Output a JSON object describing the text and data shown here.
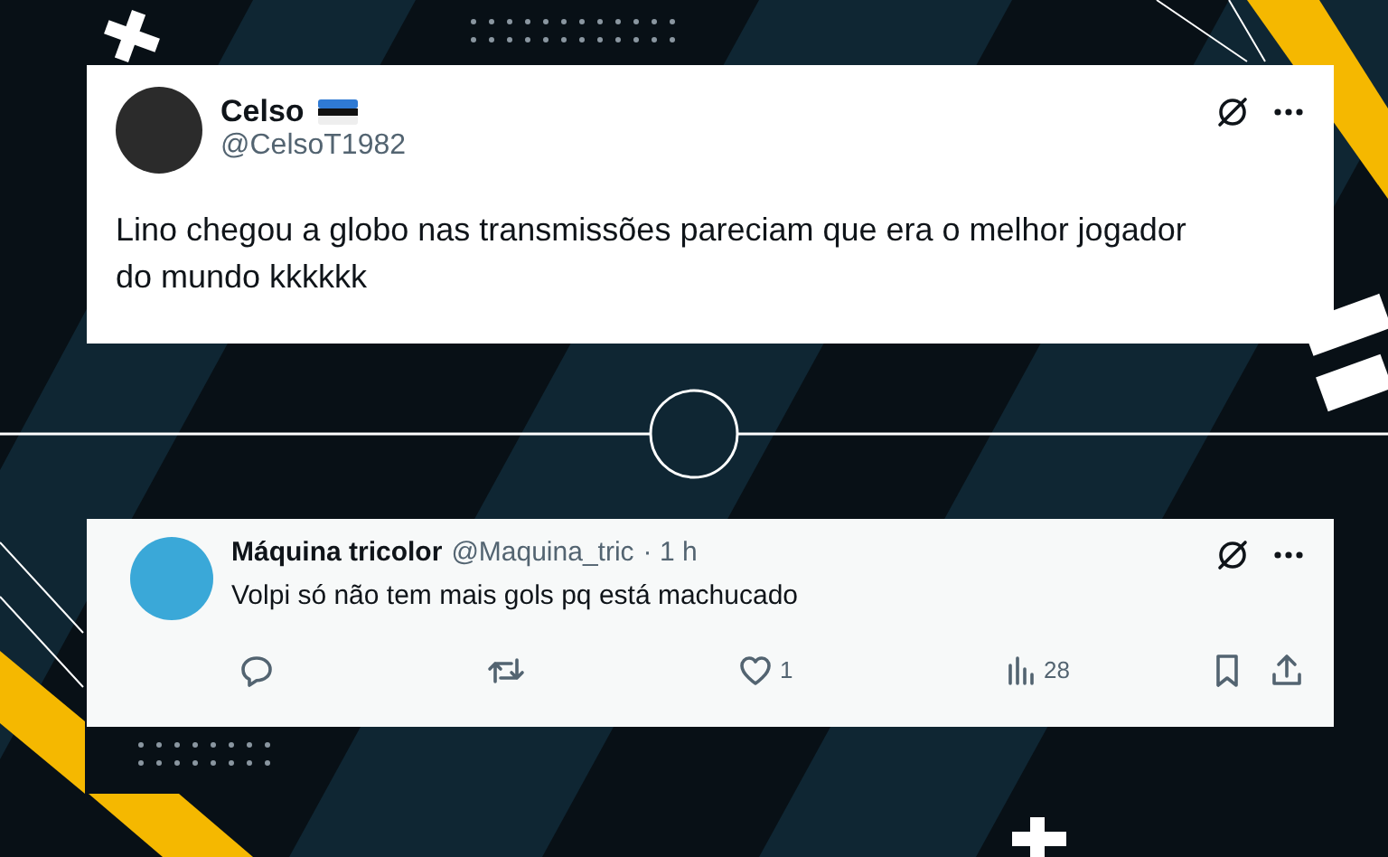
{
  "posts": [
    {
      "kind": "main",
      "name": "Celso",
      "handle": "@CelsoT1982",
      "text": "Lino chegou a globo nas transmissões pareciam que era o melhor jogador do mundo kkkkkk"
    },
    {
      "kind": "reply",
      "name": "Máquina tricolor",
      "handle": "@Maquina_tric",
      "time": "· 1 h",
      "text": "Volpi só não tem mais gols pq está machucado",
      "actions": [
        {
          "kind": "reply"
        },
        {
          "kind": "repost"
        },
        {
          "kind": "like",
          "count": "1"
        },
        {
          "kind": "views",
          "count": "28"
        },
        {
          "kind": "bookmark"
        },
        {
          "kind": "share"
        }
      ]
    }
  ]
}
